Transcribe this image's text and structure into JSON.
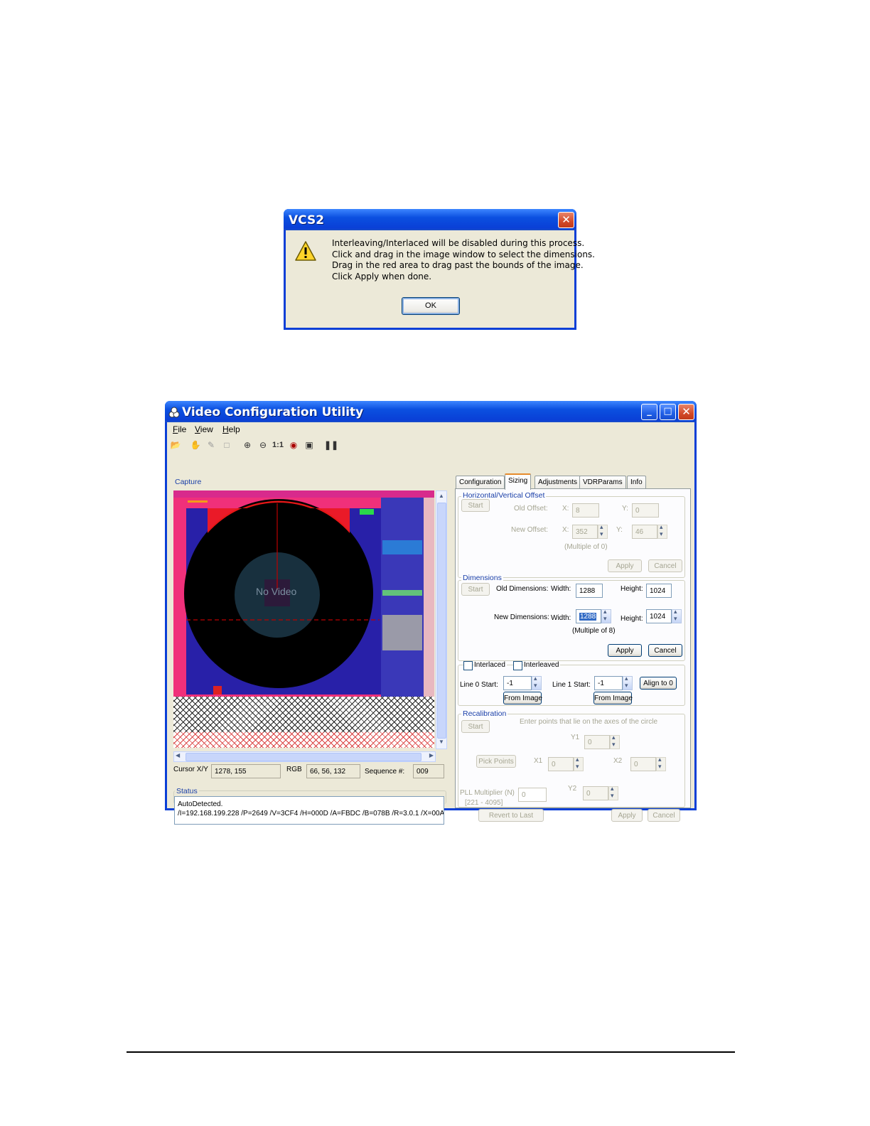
{
  "dialog": {
    "title": "VCS2",
    "close_glyph": "✕",
    "warning_icon": "warning-icon",
    "lines": [
      "Interleaving/Interlaced will be disabled during this process.",
      "Click and drag in the image window to select the dimensions.",
      "Drag in the red area to drag past the bounds of the image.",
      "Click Apply when done."
    ],
    "ok_label": "OK"
  },
  "window": {
    "title": "Video Configuration Utility",
    "menu": [
      {
        "first": "F",
        "rest": "ile"
      },
      {
        "first": "V",
        "rest": "iew"
      },
      {
        "first": "H",
        "rest": "elp"
      }
    ],
    "toolbar_icons": [
      "open-icon",
      "hand-icon",
      "pick-icon",
      "select-icon",
      "zoom-in-icon",
      "zoom-out-icon",
      "actual-size-icon",
      "record-icon",
      "fit-icon",
      "pause-icon"
    ],
    "toolbar_zoom_label": "1:1",
    "capture": {
      "title": "Capture",
      "no_video": "No Video",
      "cursor_label": "Cursor X/Y",
      "cursor_value": "1278, 155",
      "rgb_label": "RGB",
      "rgb_value": "66, 56, 132",
      "sequence_label": "Sequence #:",
      "sequence_value": "009"
    },
    "status": {
      "title": "Status",
      "line1": "AutoDetected.",
      "line2": "/I=192.168.199.228 /P=2649 /V=3CF4 /H=000D /A=FBDC /B=078B /R=3.0.1 /X=00A"
    },
    "tabs": [
      "Configuration",
      "Sizing",
      "Adjustments",
      "VDRParams",
      "Info"
    ],
    "active_tab": "Sizing",
    "offset": {
      "title": "Horizontal/Vertical Offset",
      "start": "Start",
      "old_label": "Old Offset:",
      "new_label": "New Offset:",
      "x_label": "X:",
      "y_label": "Y:",
      "old_x": "8",
      "old_y": "0",
      "new_x": "352",
      "new_y": "46",
      "note": "(Multiple of 0)",
      "apply": "Apply",
      "cancel": "Cancel"
    },
    "dimensions": {
      "title": "Dimensions",
      "start": "Start",
      "old_label": "Old Dimensions:",
      "new_label": "New Dimensions:",
      "width_label": "Width:",
      "height_label": "Height:",
      "old_width": "1288",
      "old_height": "1024",
      "new_width": "1288",
      "new_height": "1024",
      "note": "(Multiple of 8)",
      "apply": "Apply",
      "cancel": "Cancel"
    },
    "interlace": {
      "interlaced": "Interlaced",
      "interleaved": "Interleaved",
      "line0_label": "Line 0 Start:",
      "line0_value": "-1",
      "line1_label": "Line 1 Start:",
      "line1_value": "-1",
      "from_image": "From Image",
      "align": "Align to 0"
    },
    "recal": {
      "title": "Recalibration",
      "start": "Start",
      "hint": "Enter points that lie on the axes of the circle",
      "y1_label": "Y1",
      "y1_value": "0",
      "x1_label": "X1",
      "x1_value": "0",
      "x2_label": "X2",
      "x2_value": "0",
      "y2_label": "Y2",
      "y2_value": "0",
      "pick_points": "Pick Points",
      "pll_label": "PLL Multiplier (N)",
      "pll_value": "0",
      "pll_range": "[221 - 4095]",
      "revert": "Revert to Last",
      "apply": "Apply",
      "cancel": "Cancel"
    }
  }
}
